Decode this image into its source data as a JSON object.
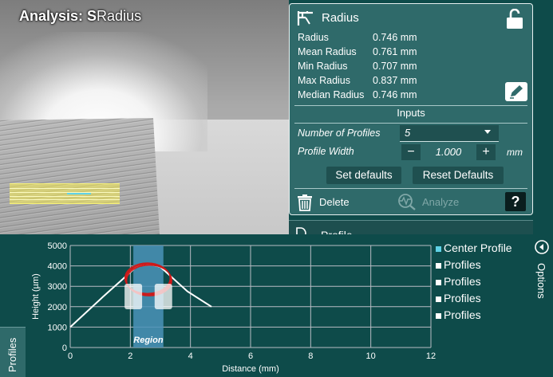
{
  "viewport": {
    "title_bold": "Analysis: S",
    "title_rest": "Radius"
  },
  "radius_panel": {
    "title": "Radius",
    "stats": [
      {
        "label": "Radius",
        "value": "0.746 mm"
      },
      {
        "label": "Mean Radius",
        "value": "0.761 mm"
      },
      {
        "label": "Min Radius",
        "value": "0.707 mm"
      },
      {
        "label": "Max Radius",
        "value": "0.837 mm"
      },
      {
        "label": "Median Radius",
        "value": "0.746 mm"
      }
    ],
    "inputs_title": "Inputs",
    "number_of_profiles_label": "Number of Profiles",
    "number_of_profiles_value": "5",
    "profile_width_label": "Profile Width",
    "profile_width_value": "1.000",
    "profile_width_unit": "mm",
    "minus": "−",
    "plus": "+",
    "set_defaults": "Set defaults",
    "reset_defaults": "Reset Defaults",
    "delete": "Delete",
    "analyze": "Analyze",
    "help": "?",
    "icons": {
      "calipers": "calipers-icon",
      "lock": "unlock-icon",
      "edit": "pencil-icon",
      "trash": "trash-icon",
      "analyze": "waveform-search-icon"
    }
  },
  "profile_panel": {
    "title": "Profile"
  },
  "profiles_tab": "Profiles",
  "options": {
    "label": "Options"
  },
  "legend": [
    {
      "label": "Center Profile",
      "color": "#5fd2e6"
    },
    {
      "label": "Profiles",
      "color": "#ffffff"
    },
    {
      "label": "Profiles",
      "color": "#ffffff"
    },
    {
      "label": "Profiles",
      "color": "#ffffff"
    },
    {
      "label": "Profiles",
      "color": "#ffffff"
    }
  ],
  "chart_data": {
    "type": "line",
    "xlabel": "Distance (mm)",
    "ylabel": "Height (µm)",
    "xlim": [
      0,
      12
    ],
    "ylim": [
      0,
      5000
    ],
    "xticks": [
      0,
      2,
      4,
      6,
      8,
      10,
      12
    ],
    "yticks": [
      0,
      1000,
      2000,
      3000,
      4000,
      5000
    ],
    "grid": true,
    "region": {
      "label": "Region",
      "x_start": 2.1,
      "x_end": 3.1
    },
    "series": [
      {
        "x": [
          0,
          1.1,
          2.2,
          2.6,
          3.0,
          3.9,
          4.7
        ],
        "y": [
          1000,
          2500,
          3950,
          4100,
          3950,
          2750,
          2000
        ]
      }
    ],
    "fit_circle": {
      "cx": 2.6,
      "cy": 3340,
      "rx_mm": 0.75,
      "ry_um": 750,
      "color": "#d01818"
    },
    "handles": [
      {
        "x": 2.1,
        "y": 2500
      },
      {
        "x": 3.1,
        "y": 2500
      }
    ]
  }
}
